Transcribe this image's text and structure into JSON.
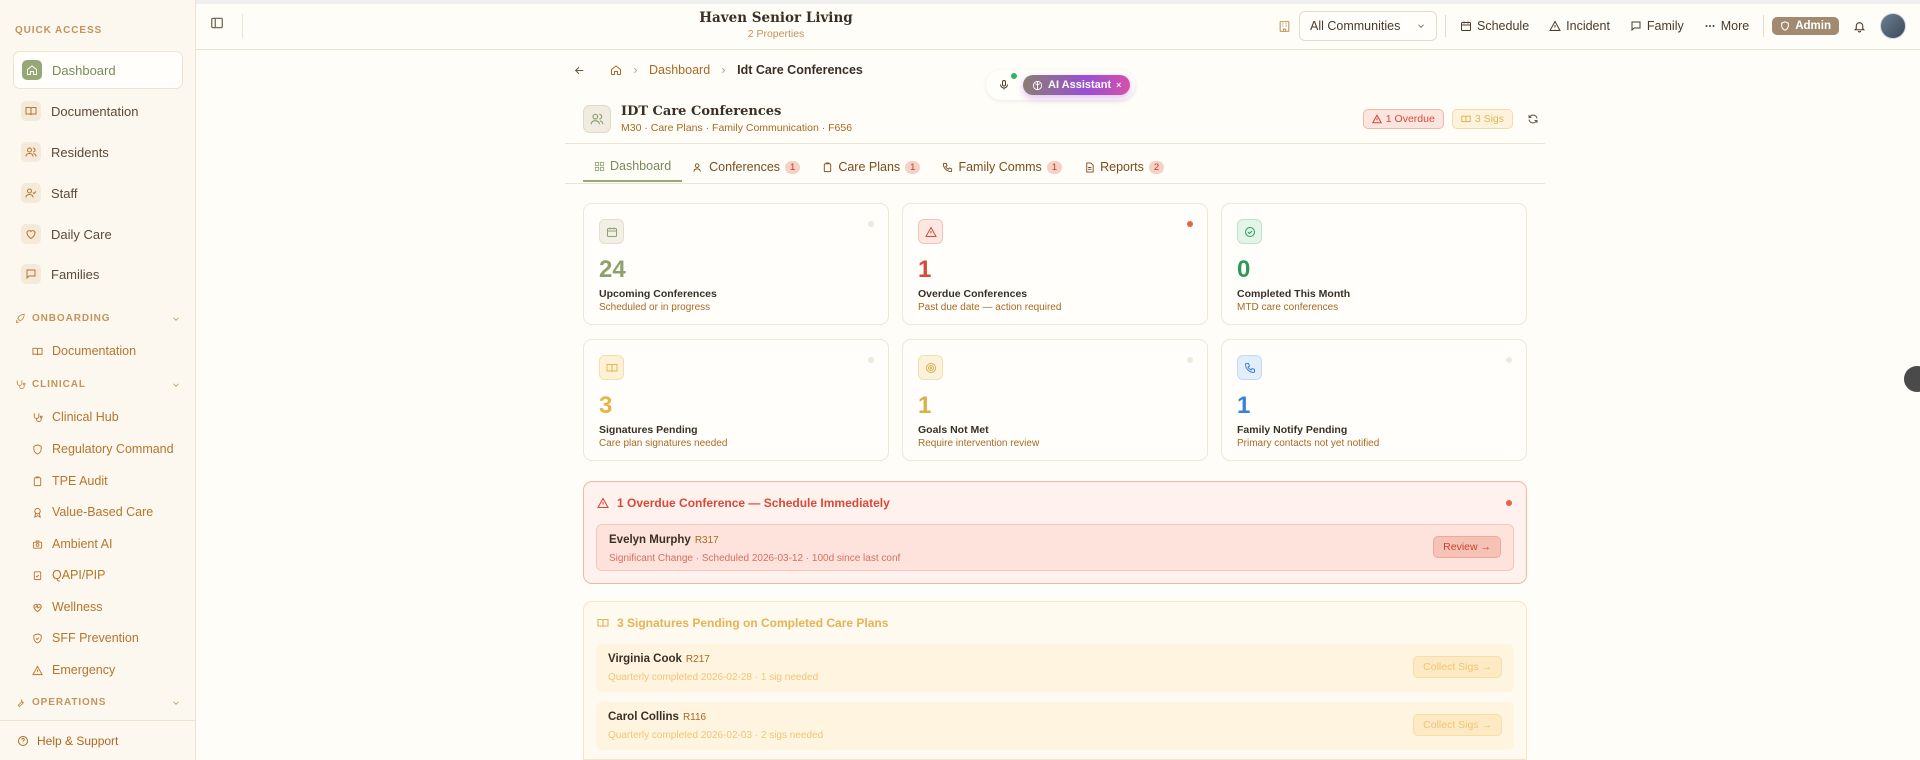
{
  "sidebar": {
    "quick_access_label": "QUICK ACCESS",
    "quick_items": [
      {
        "label": "Dashboard",
        "icon": "home-icon"
      },
      {
        "label": "Documentation",
        "icon": "book-icon"
      },
      {
        "label": "Residents",
        "icon": "users-icon"
      },
      {
        "label": "Staff",
        "icon": "user-check-icon"
      },
      {
        "label": "Daily Care",
        "icon": "heart-icon"
      },
      {
        "label": "Families",
        "icon": "message-icon"
      }
    ],
    "onboarding_label": "ONBOARDING",
    "onboarding_items": [
      {
        "label": "Documentation",
        "icon": "book-icon"
      }
    ],
    "clinical_label": "CLINICAL",
    "clinical_items": [
      {
        "label": "Clinical Hub",
        "icon": "stethoscope-icon"
      },
      {
        "label": "Regulatory Command",
        "icon": "shield-icon"
      },
      {
        "label": "TPE Audit",
        "icon": "clipboard-icon"
      },
      {
        "label": "Value-Based Care",
        "icon": "award-icon"
      },
      {
        "label": "Ambient AI",
        "icon": "camera-icon"
      },
      {
        "label": "QAPI/PIP",
        "icon": "clipboard-check-icon"
      },
      {
        "label": "Wellness",
        "icon": "heart-pulse-icon"
      },
      {
        "label": "SFF Prevention",
        "icon": "shield-check-icon"
      },
      {
        "label": "Emergency",
        "icon": "alert-triangle-icon"
      }
    ],
    "operations_label": "OPERATIONS",
    "help_label": "Help & Support"
  },
  "topbar": {
    "org_name": "Haven Senior Living",
    "org_sub": "2 Properties",
    "community_select": "All Communities",
    "schedule": "Schedule",
    "incident": "Incident",
    "family": "Family",
    "more": "More",
    "admin": "Admin"
  },
  "breadcrumb": {
    "dashboard": "Dashboard",
    "current": "Idt Care Conferences"
  },
  "ai": {
    "label": "AI Assistant",
    "close": "×"
  },
  "page": {
    "title": "IDT Care Conferences",
    "subtitle": "M30 · Care Plans · Family Communication · F656",
    "overdue_pill": "1 Overdue",
    "sigs_pill": "3 Sigs"
  },
  "tabs": [
    {
      "label": "Dashboard",
      "badge": ""
    },
    {
      "label": "Conferences",
      "badge": "1"
    },
    {
      "label": "Care Plans",
      "badge": "1"
    },
    {
      "label": "Family Comms",
      "badge": "1"
    },
    {
      "label": "Reports",
      "badge": "2"
    }
  ],
  "stats": [
    {
      "value": "24",
      "label": "Upcoming Conferences",
      "sub": "Scheduled or in progress",
      "color": "#8fa06c",
      "icon": "calendar-icon"
    },
    {
      "value": "1",
      "label": "Overdue Conferences",
      "sub": "Past due date — action required",
      "color": "#d64a38",
      "icon": "alert-triangle-icon"
    },
    {
      "value": "0",
      "label": "Completed This Month",
      "sub": "MTD care conferences",
      "color": "#2e9a58",
      "icon": "check-circle-icon"
    },
    {
      "value": "3",
      "label": "Signatures Pending",
      "sub": "Care plan signatures needed",
      "color": "#e7b448",
      "icon": "book-open-icon"
    },
    {
      "value": "1",
      "label": "Goals Not Met",
      "sub": "Require intervention review",
      "color": "#d9b04a",
      "icon": "target-icon"
    },
    {
      "value": "1",
      "label": "Family Notify Pending",
      "sub": "Primary contacts not yet notified",
      "color": "#3b82d6",
      "icon": "phone-icon"
    }
  ],
  "overdue_alert": {
    "title": "1 Overdue Conference — Schedule Immediately",
    "rows": [
      {
        "name": "Evelyn Murphy",
        "room": "R317",
        "detail": "Significant Change · Scheduled 2026-03-12 · 100d since last conf",
        "action": "Review →"
      }
    ]
  },
  "sigs_alert": {
    "title": "3 Signatures Pending on Completed Care Plans",
    "rows": [
      {
        "name": "Virginia Cook",
        "room": "R217",
        "detail": "Quarterly completed 2026-02-28 · 1 sig needed",
        "action": "Collect Sigs →"
      },
      {
        "name": "Carol Collins",
        "room": "R116",
        "detail": "Quarterly completed 2026-02-03 · 2 sigs needed",
        "action": "Collect Sigs →"
      }
    ]
  },
  "colors": {
    "accent": "#97a877",
    "danger": "#d64a38",
    "warning": "#e5b354",
    "link": "#a76a24"
  }
}
